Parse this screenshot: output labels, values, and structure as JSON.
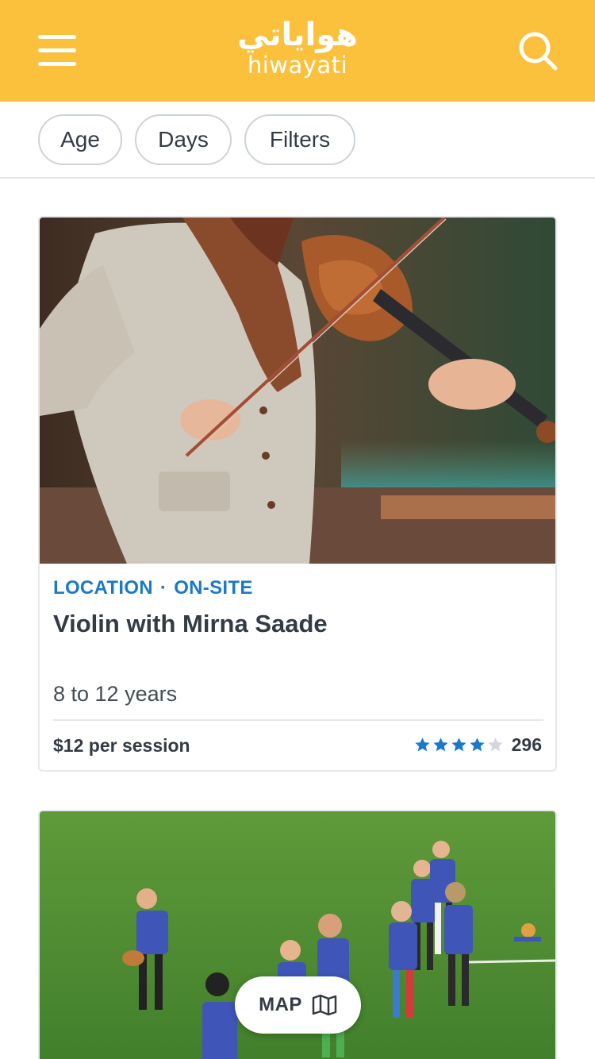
{
  "header": {
    "logo_ar": "هواياتي",
    "logo_en": "hiwayati",
    "background": "#fcc13c"
  },
  "filters": [
    {
      "label": "Age"
    },
    {
      "label": "Days"
    },
    {
      "label": "Filters"
    }
  ],
  "listings": [
    {
      "location": "LOCATION",
      "separator": "·",
      "mode": "ON-SITE",
      "title": "Violin with Mirna Saade",
      "age_range": "8 to 12 years",
      "price": "$12 per session",
      "rating": 4,
      "rating_max": 5,
      "review_count": "296",
      "image_icon": "violin-player-photo"
    },
    {
      "image_icon": "kids-rugby-field-photo"
    }
  ],
  "map_button": {
    "label": "MAP",
    "icon": "map-icon"
  },
  "colors": {
    "accent_blue": "#1a7ac9",
    "star_filled": "#1a7ac9",
    "star_empty": "#d3d7db"
  }
}
